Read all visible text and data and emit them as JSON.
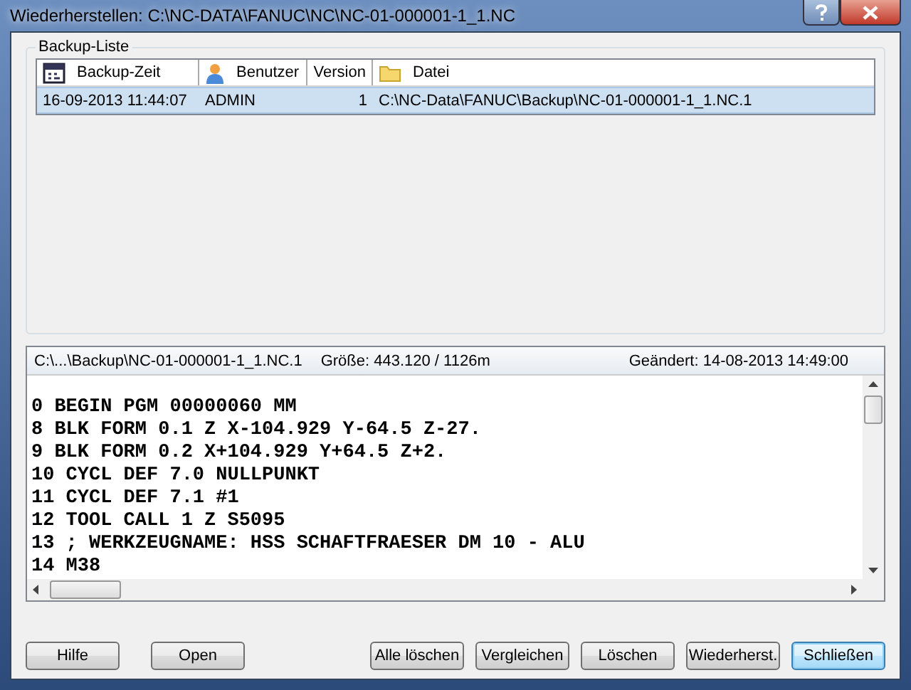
{
  "window": {
    "title": "Wiederherstellen: C:\\NC-DATA\\FANUC\\NC\\NC-01-000001-1_1.NC"
  },
  "backup_list": {
    "title": "Backup-Liste",
    "columns": [
      "Backup-Zeit",
      "Benutzer",
      "Version",
      "Datei"
    ],
    "rows": [
      {
        "cells": [
          "16-09-2013 11:44:07",
          "ADMIN",
          "1",
          "C:\\NC-Data\\FANUC\\Backup\\NC-01-000001-1_1.NC.1"
        ],
        "selected": true
      }
    ]
  },
  "preview": {
    "file": "C:\\...\\Backup\\NC-01-000001-1_1.NC.1",
    "size": "Größe: 443.120 / 1126m",
    "modified": "Geändert: 14-08-2013 14:49:00",
    "lines": [
      "0 BEGIN PGM 00000060 MM",
      "8 BLK FORM 0.1 Z X-104.929 Y-64.5 Z-27.",
      "9 BLK FORM 0.2 X+104.929 Y+64.5 Z+2.",
      "10 CYCL DEF 7.0 NULLPUNKT",
      "11 CYCL DEF 7.1 #1",
      "12 TOOL CALL 1 Z S5095",
      "13 ; WERKZEUGNAME: HSS SCHAFTFRAESER DM 10 - ALU",
      "14 M38"
    ]
  },
  "buttons_left": [
    {
      "label": "Hilfe",
      "selected": false
    },
    {
      "label": "Open",
      "selected": false
    }
  ],
  "buttons_right": [
    {
      "label": "Alle löschen",
      "selected": false
    },
    {
      "label": "Vergleichen",
      "selected": false
    },
    {
      "label": "Löschen",
      "selected": false
    },
    {
      "label": "Wiederherst.",
      "selected": false
    },
    {
      "label": "Schließen",
      "selected": true
    }
  ]
}
